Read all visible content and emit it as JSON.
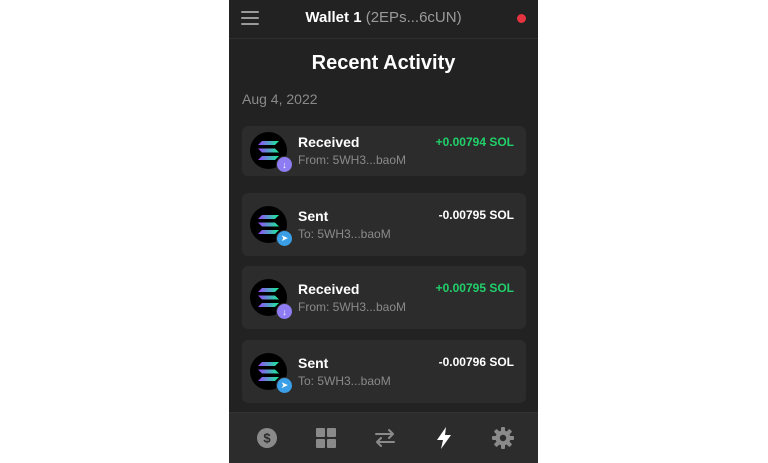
{
  "header": {
    "wallet_name": "Wallet 1",
    "wallet_address": "(2EPs...6cUN)",
    "status_color": "#e5343f"
  },
  "page": {
    "title": "Recent Activity",
    "date": "Aug 4, 2022"
  },
  "transactions": [
    {
      "kind": "Received",
      "party": "From: 5WH3...baoM",
      "amount": "+0.00794 SOL",
      "direction": "in",
      "badge_icon": "arrow-down-icon"
    },
    {
      "kind": "Sent",
      "party": "To: 5WH3...baoM",
      "amount": "-0.00795 SOL",
      "direction": "out",
      "badge_icon": "send-icon"
    },
    {
      "kind": "Received",
      "party": "From: 5WH3...baoM",
      "amount": "+0.00795 SOL",
      "direction": "in",
      "badge_icon": "arrow-down-icon"
    },
    {
      "kind": "Sent",
      "party": "To: 5WH3...baoM",
      "amount": "-0.00796 SOL",
      "direction": "out",
      "badge_icon": "send-icon"
    }
  ],
  "nav": {
    "items": [
      "dollar-icon",
      "grid-icon",
      "swap-icon",
      "lightning-icon",
      "gear-icon"
    ],
    "active": "lightning-icon"
  },
  "colors": {
    "positive": "#21d06a",
    "received_badge": "#8e7cf2",
    "sent_badge": "#3a9fe6"
  }
}
